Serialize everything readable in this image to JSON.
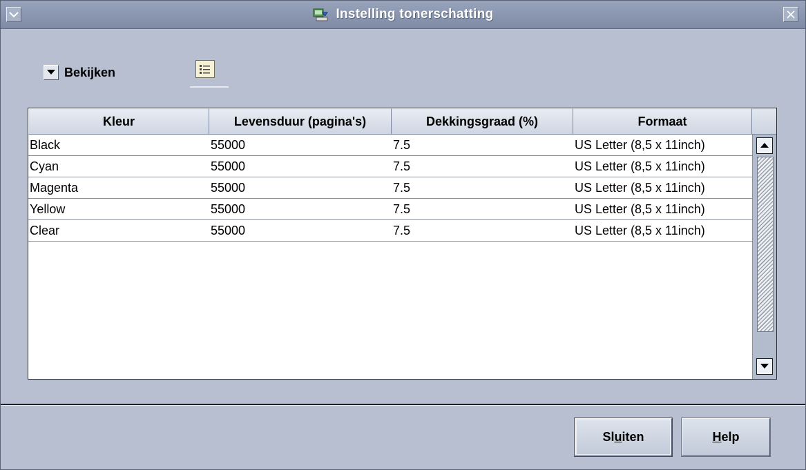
{
  "window": {
    "title": "Instelling tonerschatting",
    "title_icon": "printer-settings-icon",
    "minimize_icon": "chevron-down-icon",
    "close_icon": "close-icon"
  },
  "toolbar": {
    "view_label": "Bekijken",
    "view_icon": "dropdown-arrow-icon",
    "list_view_icon": "list-view-icon"
  },
  "table": {
    "columns": [
      "Kleur",
      "Levensduur (pagina's)",
      "Dekkingsgraad (%)",
      "Formaat"
    ],
    "rows": [
      [
        "Black",
        "55000",
        "7.5",
        "US Letter (8,5 x 11inch)"
      ],
      [
        "Cyan",
        "55000",
        "7.5",
        "US Letter (8,5 x 11inch)"
      ],
      [
        "Magenta",
        "55000",
        "7.5",
        "US Letter (8,5 x 11inch)"
      ],
      [
        "Yellow",
        "55000",
        "7.5",
        "US Letter (8,5 x 11inch)"
      ],
      [
        "Clear",
        "55000",
        "7.5",
        "US Letter (8,5 x 11inch)"
      ]
    ]
  },
  "buttons": {
    "close_pre": "Sl",
    "close_mnemonic": "u",
    "close_post": "iten",
    "help_mnemonic": "H",
    "help_post": "elp"
  },
  "colors": {
    "window_bg": "#b7bfd0",
    "titlebar": "#8a95ae",
    "title_text": "#ffffff"
  }
}
